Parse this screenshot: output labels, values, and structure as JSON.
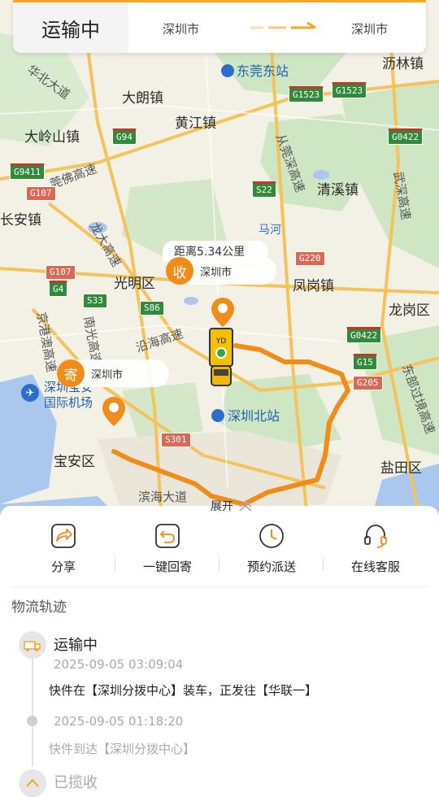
{
  "status": {
    "title": "运输中",
    "from_city": "深圳市",
    "to_city": "深圳市"
  },
  "map": {
    "places": {
      "dongguan_east": "东莞东站",
      "lilin": "沥林镇",
      "dalang": "大朗镇",
      "huangjiang": "黄江镇",
      "dalingshan": "大岭山镇",
      "qingxi": "清溪镇",
      "changan": "长安镇",
      "guangming": "光明区",
      "fenggang": "凤岗镇",
      "longgang": "龙岗区",
      "baoan": "宝安区",
      "yantian": "盐田区",
      "shenzhen_north": "深圳北站",
      "shenzhen_airport_1": "深圳宝安",
      "shenzhen_airport_2": "国际机场",
      "binhai": "滨海大道",
      "mahe": "马河"
    },
    "roads": {
      "guanfo": "莞佛高速",
      "longda": "龙大高速",
      "jinggang": "京港澳高速",
      "nanguang": "南光高速",
      "yanjiang": "沿海高速",
      "guanshen": "从莞深高速",
      "wushen": "武深高速",
      "dongbu": "东部过境高速",
      "huabei": "华北大道"
    },
    "shields": [
      "G1523",
      "G1523",
      "G94",
      "G0422",
      "G9411",
      "G107",
      "S22",
      "G220",
      "G107",
      "G4",
      "S33",
      "S86",
      "G0422",
      "G15",
      "G205",
      "S301"
    ],
    "distance_label": "距离5.34公里",
    "receiver": {
      "tag": "收",
      "city": "深圳市"
    },
    "sender": {
      "tag": "寄",
      "city": "深圳市"
    }
  },
  "expand_label": "展开",
  "actions": [
    {
      "label": "分享",
      "icon": "share-icon"
    },
    {
      "label": "一键回寄",
      "icon": "return-icon"
    },
    {
      "label": "预约派送",
      "icon": "clock-icon"
    },
    {
      "label": "在线客服",
      "icon": "headset-icon"
    }
  ],
  "track": {
    "title": "物流轨迹",
    "events": [
      {
        "status": "运输中",
        "time": "2025-09-05 03:09:04",
        "desc": "快件在【深圳分拨中心】装车，正发往【华联一】"
      },
      {
        "status": "",
        "time": "2025-09-05 01:18:20",
        "desc": "快件到达【深圳分拨中心】"
      },
      {
        "status": "已揽收",
        "time": "",
        "desc": ""
      }
    ]
  },
  "colors": {
    "accent": "#f08c1a",
    "route": "#f08c1a",
    "brand_yellow": "#f5a623"
  }
}
